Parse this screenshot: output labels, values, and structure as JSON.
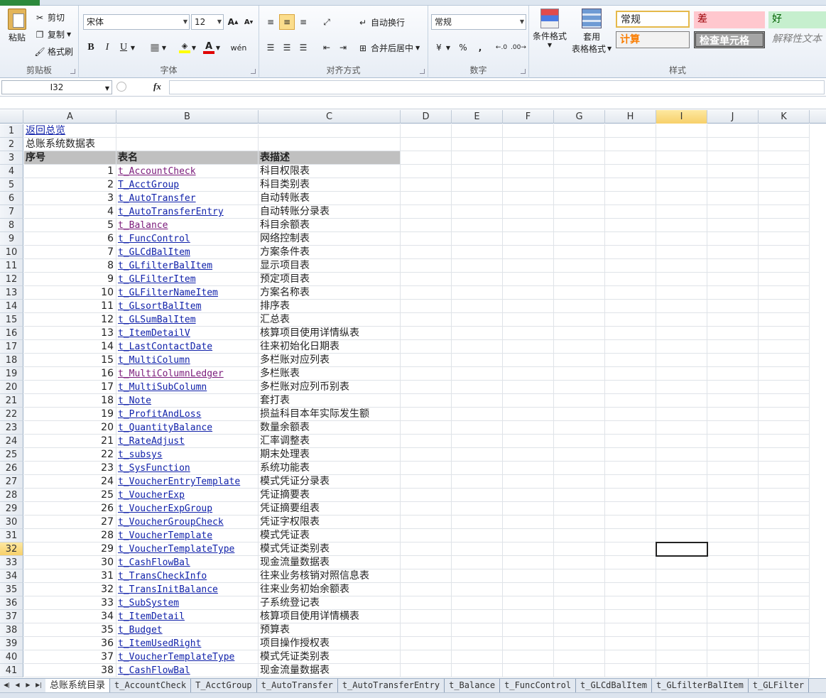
{
  "ribbon": {
    "clipboard": {
      "label": "剪贴板",
      "paste": "粘贴",
      "cut": "剪切",
      "copy": "复制",
      "format_painter": "格式刷"
    },
    "font": {
      "label": "字体",
      "family": "宋体",
      "size": "12"
    },
    "alignment": {
      "label": "对齐方式",
      "wrap": "自动换行",
      "merge": "合并后居中"
    },
    "number": {
      "label": "数字",
      "format": "常规",
      "percent": "%",
      "comma": ","
    },
    "styles": {
      "label": "样式",
      "conditional": "条件格式",
      "table_format_line1": "套用",
      "table_format_line2": "表格格式",
      "normal": "常规",
      "bad": "差",
      "good": "好",
      "calc": "计算",
      "check": "检查单元格",
      "explain": "解释性文本"
    }
  },
  "formula_bar": {
    "name_box": "I32",
    "fx": "fx",
    "value": ""
  },
  "columns": [
    {
      "label": "A",
      "w": 130
    },
    {
      "label": "B",
      "w": 200
    },
    {
      "label": "C",
      "w": 200
    },
    {
      "label": "D",
      "w": 72
    },
    {
      "label": "E",
      "w": 72
    },
    {
      "label": "F",
      "w": 72
    },
    {
      "label": "G",
      "w": 72
    },
    {
      "label": "H",
      "w": 72
    },
    {
      "label": "I",
      "w": 72
    },
    {
      "label": "J",
      "w": 72
    },
    {
      "label": "K",
      "w": 72
    }
  ],
  "selected_col": "I",
  "selected_row": "32",
  "sheet": {
    "row1_link": "返回总览",
    "row2_title": "总账系统数据表",
    "header": {
      "seq": "序号",
      "name": "表名",
      "desc": "表描述"
    },
    "rows": [
      {
        "n": "1",
        "name": "t_AccountCheck",
        "desc": "科目权限表",
        "visited": true
      },
      {
        "n": "2",
        "name": "T_AcctGroup",
        "desc": "科目类别表"
      },
      {
        "n": "3",
        "name": "t_AutoTransfer",
        "desc": "自动转账表"
      },
      {
        "n": "4",
        "name": "t_AutoTransferEntry",
        "desc": "自动转账分录表"
      },
      {
        "n": "5",
        "name": "t_Balance",
        "desc": "科目余额表",
        "visited": true
      },
      {
        "n": "6",
        "name": "t_FuncControl",
        "desc": "网络控制表"
      },
      {
        "n": "7",
        "name": "t_GLCdBalItem",
        "desc": "方案条件表"
      },
      {
        "n": "8",
        "name": "t_GLfilterBalItem",
        "desc": "显示项目表"
      },
      {
        "n": "9",
        "name": "t_GLFilterItem",
        "desc": "预定项目表"
      },
      {
        "n": "10",
        "name": "t_GLFilterNameItem",
        "desc": "方案名称表"
      },
      {
        "n": "11",
        "name": "t_GLsortBalItem",
        "desc": "排序表"
      },
      {
        "n": "12",
        "name": "t_GLSumBalItem",
        "desc": "汇总表"
      },
      {
        "n": "13",
        "name": "t_ItemDetailV",
        "desc": "核算项目使用详情纵表"
      },
      {
        "n": "14",
        "name": "t_LastContactDate",
        "desc": "往来初始化日期表"
      },
      {
        "n": "15",
        "name": "t_MultiColumn",
        "desc": "多栏账对应列表"
      },
      {
        "n": "16",
        "name": "t_MultiColumnLedger",
        "desc": "多栏账表",
        "visited": true
      },
      {
        "n": "17",
        "name": "t_MultiSubColumn",
        "desc": "多栏账对应列币别表"
      },
      {
        "n": "18",
        "name": "t_Note",
        "desc": "套打表"
      },
      {
        "n": "19",
        "name": "t_ProfitAndLoss",
        "desc": "损益科目本年实际发生额"
      },
      {
        "n": "20",
        "name": "t_QuantityBalance",
        "desc": "数量余额表"
      },
      {
        "n": "21",
        "name": "t_RateAdjust",
        "desc": "汇率调整表"
      },
      {
        "n": "22",
        "name": "t_subsys",
        "desc": "期末处理表"
      },
      {
        "n": "23",
        "name": "t_SysFunction",
        "desc": "系统功能表"
      },
      {
        "n": "24",
        "name": "t_VoucherEntryTemplate",
        "desc": "模式凭证分录表"
      },
      {
        "n": "25",
        "name": "t_VoucherExp",
        "desc": "凭证摘要表"
      },
      {
        "n": "26",
        "name": "t_VoucherExpGroup",
        "desc": "凭证摘要组表"
      },
      {
        "n": "27",
        "name": "t_VoucherGroupCheck",
        "desc": "凭证字权限表"
      },
      {
        "n": "28",
        "name": "t_VoucherTemplate",
        "desc": "模式凭证表"
      },
      {
        "n": "29",
        "name": "t_VoucherTemplateType",
        "desc": "模式凭证类别表"
      },
      {
        "n": "30",
        "name": "t_CashFlowBal",
        "desc": "现金流量数据表"
      },
      {
        "n": "31",
        "name": "t_TransCheckInfo",
        "desc": "往来业务核销对照信息表"
      },
      {
        "n": "32",
        "name": "t_TransInitBalance",
        "desc": "往来业务初始余额表"
      },
      {
        "n": "33",
        "name": "t_SubSystem",
        "desc": "子系统登记表"
      },
      {
        "n": "34",
        "name": "t_ItemDetail",
        "desc": "核算项目使用详情横表"
      },
      {
        "n": "35",
        "name": "t_Budget",
        "desc": "预算表"
      },
      {
        "n": "36",
        "name": "t_ItemUsedRight",
        "desc": "项目操作授权表"
      },
      {
        "n": "37",
        "name": "t_VoucherTemplateType",
        "desc": "模式凭证类别表"
      },
      {
        "n": "38",
        "name": "t_CashFlowBal",
        "desc": "现金流量数据表"
      }
    ]
  },
  "sheet_tabs": [
    "总账系统目录",
    "t_AccountCheck",
    "T_AcctGroup",
    "t_AutoTransfer",
    "t_AutoTransferEntry",
    "t_Balance",
    "t_FuncControl",
    "t_GLCdBalItem",
    "t_GLfilterBalItem",
    "t_GLFilter"
  ],
  "colors": {
    "link": "#1122aa",
    "visited": "#7a1a7a",
    "header_fill": "#c0c0c0",
    "selected_header": "#f7d06a"
  }
}
